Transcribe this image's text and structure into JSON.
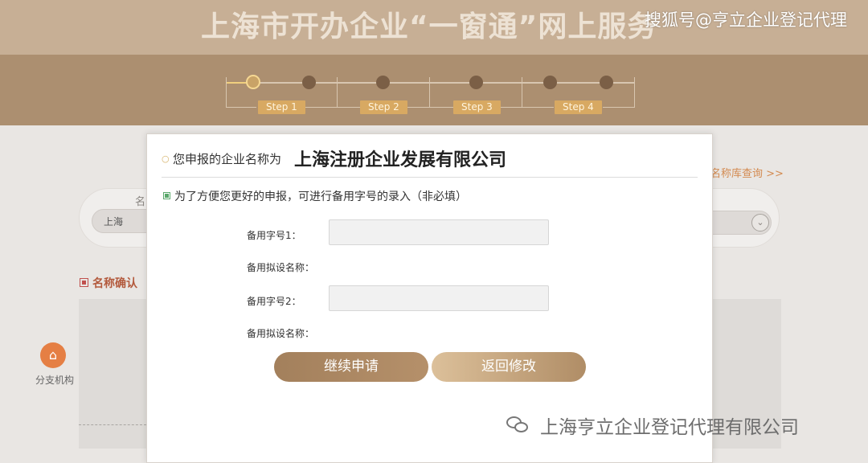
{
  "header": {
    "title": "上海市开办企业“一窗通”网上服务",
    "watermark": "搜狐号@亨立企业登记代理"
  },
  "steps": [
    {
      "label": "Step 1"
    },
    {
      "label": "Step 2"
    },
    {
      "label": "Step 3"
    },
    {
      "label": "Step 4"
    }
  ],
  "background_page": {
    "city_value": "上海",
    "field_label_partial": "名",
    "name_search_link": "名称库查询 >>",
    "section_title": "名称确认",
    "sidebar_item": "分支机构",
    "select_icon": "chevron-down-icon"
  },
  "modal": {
    "heading_label": "您申报的企业名称为",
    "company_name": "上海注册企业发展有限公司",
    "tip": "为了方便您更好的申报，可进行备用字号的录入（非必填）",
    "fields": [
      {
        "label": "备用字号1：",
        "value": "",
        "sub_label": "备用拟设名称："
      },
      {
        "label": "备用字号2：",
        "value": "",
        "sub_label": "备用拟设名称："
      }
    ],
    "continue_button": "继续申请",
    "return_button": "返回修改"
  },
  "watermark_bottom": "上海亨立企业登记代理有限公司",
  "colors": {
    "banner": "#c7af95",
    "steps_band": "#ac8f70",
    "step_pill": "#d8a962",
    "accent_link": "#d38a50",
    "button_primary": "#a3805c",
    "button_secondary": "#dcc09a"
  }
}
